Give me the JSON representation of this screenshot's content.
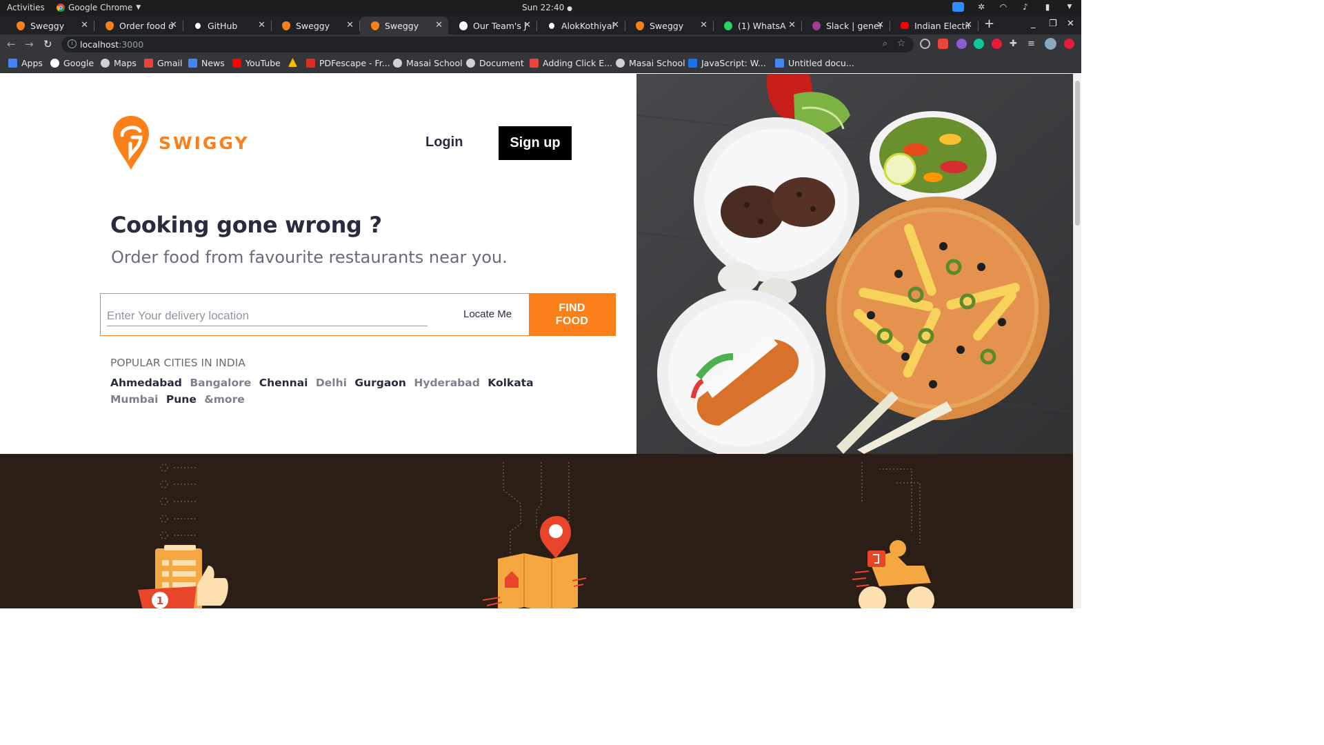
{
  "os": {
    "activities": "Activities",
    "app_name": "Google Chrome",
    "clock": "Sun 22:40"
  },
  "tabs": [
    {
      "title": "Sweggy",
      "icon": "swiggy-icon",
      "active": false
    },
    {
      "title": "Order food o",
      "icon": "swiggy-icon",
      "active": false
    },
    {
      "title": "GitHub",
      "icon": "github-icon",
      "active": false
    },
    {
      "title": "Sweggy",
      "icon": "swiggy-icon",
      "active": false
    },
    {
      "title": "Sweggy",
      "icon": "swiggy-icon",
      "active": true
    },
    {
      "title": "Our Team's J",
      "icon": "video-icon",
      "active": false
    },
    {
      "title": "AlokKothiyal",
      "icon": "github-icon",
      "active": false
    },
    {
      "title": "Sweggy",
      "icon": "swiggy-icon",
      "active": false
    },
    {
      "title": "(1) WhatsA",
      "icon": "whatsapp-icon",
      "active": false
    },
    {
      "title": "Slack | genera",
      "icon": "slack-icon",
      "active": false
    },
    {
      "title": "Indian Electio",
      "icon": "youtube-icon",
      "active": false
    }
  ],
  "address": {
    "host": "localhost",
    "port": ":3000"
  },
  "bookmarks": [
    {
      "label": "Apps",
      "icon": "apps-grid-icon"
    },
    {
      "label": "Google",
      "icon": "google-icon"
    },
    {
      "label": "Maps",
      "icon": "globe-icon"
    },
    {
      "label": "Gmail",
      "icon": "gmail-icon"
    },
    {
      "label": "News",
      "icon": "news-icon"
    },
    {
      "label": "YouTube",
      "icon": "youtube-icon"
    },
    {
      "label": "",
      "icon": "drive-icon"
    },
    {
      "label": "PDFescape - Fr...",
      "icon": "pdf-icon"
    },
    {
      "label": "Masai School",
      "icon": "globe-icon"
    },
    {
      "label": "Document",
      "icon": "globe-icon"
    },
    {
      "label": "Adding Click E...",
      "icon": "bookmark-icon"
    },
    {
      "label": "Masai School",
      "icon": "globe-icon"
    },
    {
      "label": "JavaScript: W...",
      "icon": "js-icon"
    },
    {
      "label": "Untitled docu...",
      "icon": "docs-icon"
    }
  ],
  "site": {
    "brand": "SWIGGY",
    "login": "Login",
    "signup": "Sign up",
    "headline": "Cooking gone wrong ?",
    "subheadline": "Order food from favourite restaurants near you.",
    "search_placeholder": "Enter Your delivery location",
    "locate_me": "Locate Me",
    "find_food_line1": "FIND",
    "find_food_line2": "FOOD",
    "popular_title": "POPULAR CITIES IN INDIA",
    "cities": [
      {
        "name": "Ahmedabad",
        "tone": "dark"
      },
      {
        "name": "Bangalore",
        "tone": "light"
      },
      {
        "name": "Chennai",
        "tone": "dark"
      },
      {
        "name": "Delhi",
        "tone": "light"
      },
      {
        "name": "Gurgaon",
        "tone": "dark"
      },
      {
        "name": "Hyderabad",
        "tone": "light"
      },
      {
        "name": "Kolkata",
        "tone": "dark"
      },
      {
        "name": "Mumbai",
        "tone": "light"
      },
      {
        "name": "Pune",
        "tone": "dark"
      },
      {
        "name": "&more",
        "tone": "light"
      }
    ],
    "order_badge": "1"
  },
  "colors": {
    "brand_orange": "#fc8019",
    "dark_band": "#2b1e16",
    "text_dark": "#282c3f",
    "text_muted": "#686b78"
  }
}
